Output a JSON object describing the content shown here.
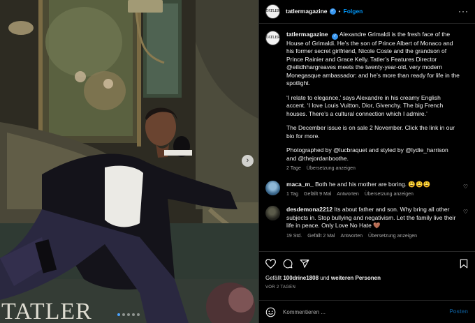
{
  "media": {
    "watermark": "TATLER",
    "carousel_dots": 5,
    "active_dot": 0,
    "next_glyph": "›"
  },
  "header": {
    "avatar_text": "TATLER",
    "username": "tatlermagazine",
    "verified_icon": "✓",
    "separator": "•",
    "follow_label": "Folgen",
    "more_icon": "···"
  },
  "caption": {
    "username": "tatlermagazine",
    "paragraph_1": "Alexandre Grimaldi is the fresh face of the House of Grimaldi. He’s the son of Prince Albert of Monaco and his former secret girlfriend, Nicole Coste and the grandson of Prince Rainier and Grace Kelly. Tatler’s Features Director @eilidhhargreaves meets the twenty-year-old, very modern Monegasque ambassador: and he’s more than ready for life in the spotlight.",
    "paragraph_2": "‘I relate to elegance,’ says Alexandre in his creamy English accent. ‘I love Louis Vuitton, Dior, Givenchy. The big French houses. There’s a cultural connection which I admire.’",
    "paragraph_3": "The December issue is on sale 2 November. Click the link in our bio for more.",
    "paragraph_4": "Photographed by @lucbraquet and styled by @lydie_harrison and @thejordanboothe.",
    "time": "2 Tage",
    "translate": "Übersetzung anzeigen"
  },
  "comments": [
    {
      "username": "maca_m_",
      "text": "Both he and his mother are boring. 😩😩😩",
      "time": "1 Tag",
      "likes": "Gefällt 9 Mal",
      "reply": "Antworten",
      "translate": "Übersetzung anzeigen"
    },
    {
      "username": "desdemona2212",
      "text": "Its about father and son. Why bring all other subjects in. Stop bullying and negativism. Let the family live their life in peace. Only Love No Hate 🤎",
      "time": "19 Std.",
      "likes": "Gefällt 2 Mal",
      "reply": "Antworten",
      "translate": "Übersetzung anzeigen"
    }
  ],
  "footer": {
    "likes_prefix": "Gefällt ",
    "likes_user": "100drine1808",
    "likes_middle": " und ",
    "likes_others": "weiteren Personen",
    "time": "VOR 2 TAGEN",
    "comment_placeholder": "Kommentieren ...",
    "post_label": "Posten"
  },
  "colors": {
    "accent": "#0095f6",
    "verified": "#3897f0",
    "active_dot": "#4aa3ff"
  }
}
